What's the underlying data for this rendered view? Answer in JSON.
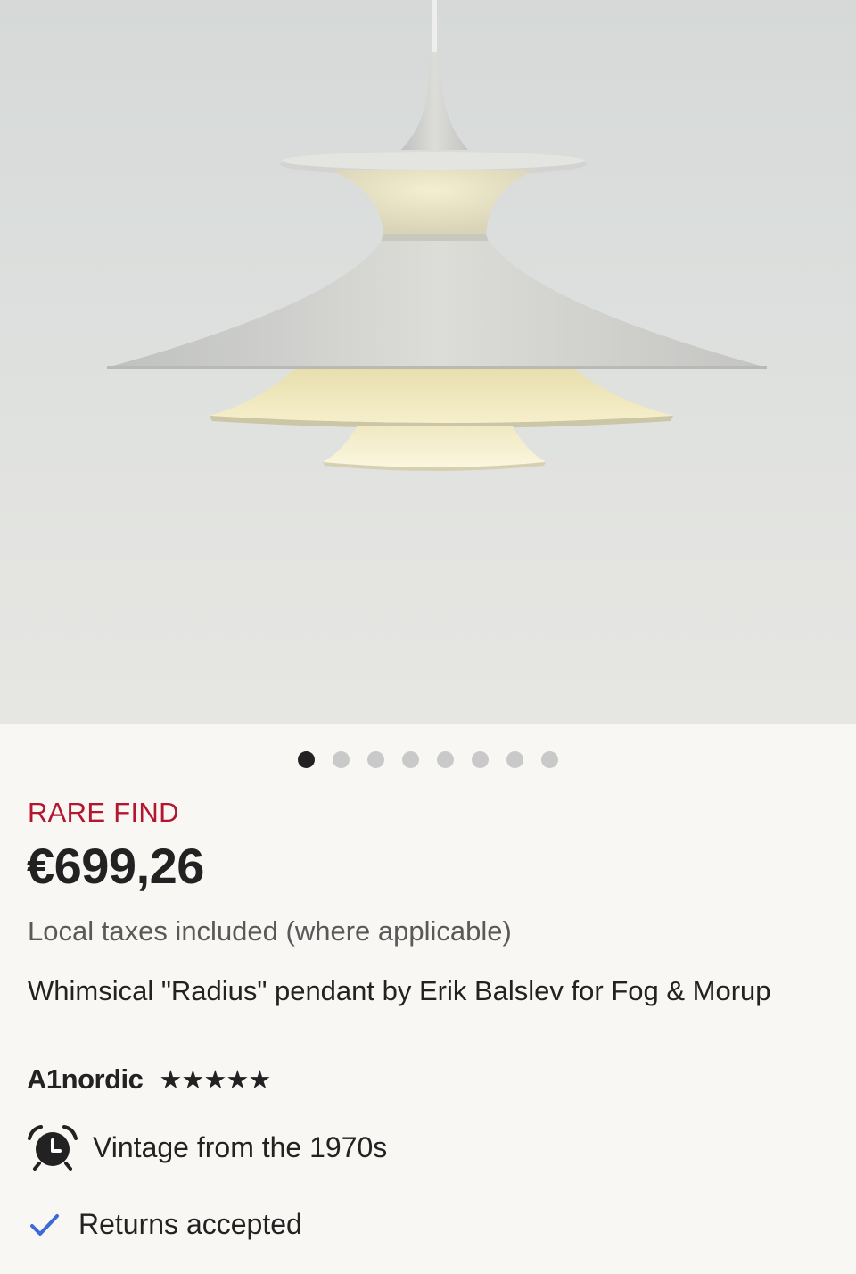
{
  "carousel": {
    "total": 8,
    "active_index": 0
  },
  "listing": {
    "badge": "RARE FIND",
    "price": "€699,26",
    "tax_note": "Local taxes included (where applicable)",
    "title": "Whimsical \"Radius\" pendant by Erik Balslev for Fog & Morup",
    "seller": "A1nordic",
    "rating_stars": 5,
    "stars_text": "★★★★★",
    "features": [
      {
        "icon": "alarm-clock-icon",
        "text": "Vintage from the 1970s"
      },
      {
        "icon": "checkmark-icon",
        "text": "Returns accepted"
      }
    ]
  },
  "colors": {
    "badge": "#b3162f",
    "accent_check": "#3d6ad6",
    "dot_active": "#222222",
    "dot_inactive": "#c9c9c9"
  }
}
